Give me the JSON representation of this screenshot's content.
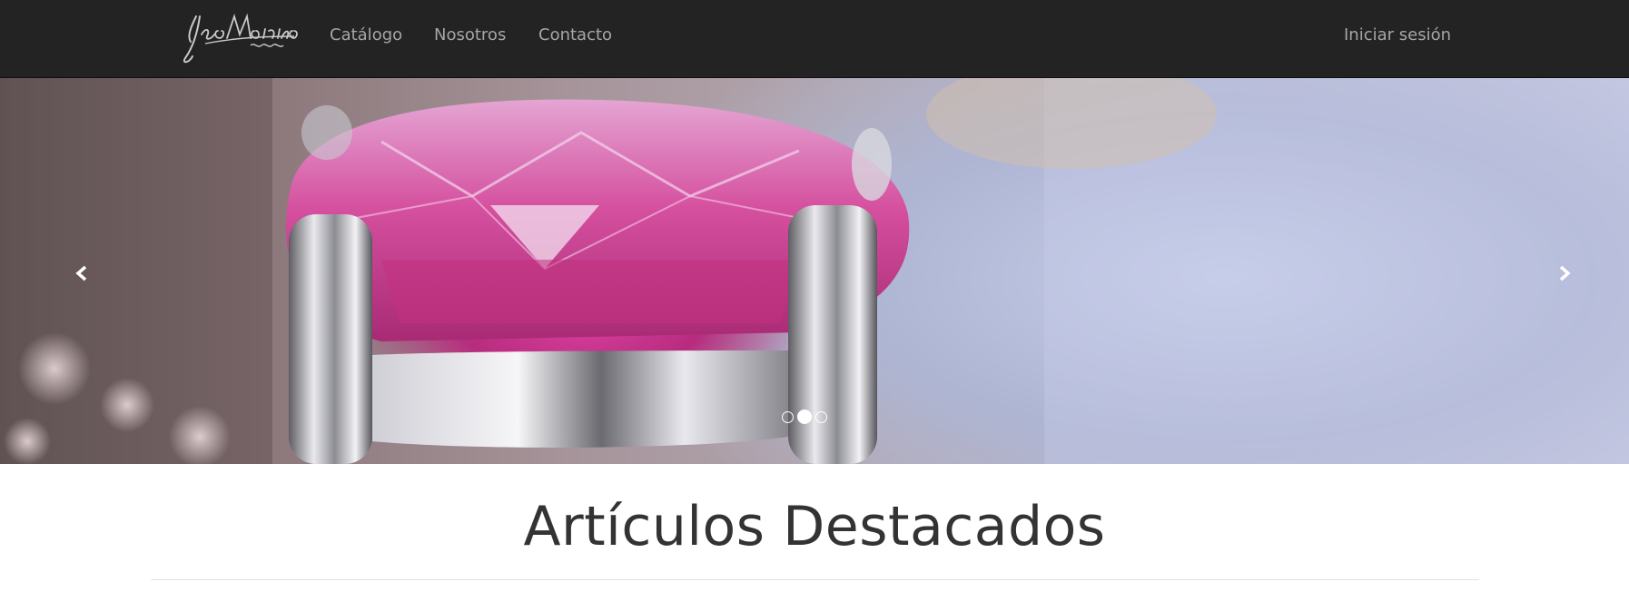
{
  "brand": {
    "logo_text": "YsaMarina",
    "logo_icon": "signature-logo"
  },
  "nav": {
    "links": [
      {
        "label": "Catálogo"
      },
      {
        "label": "Nosotros"
      },
      {
        "label": "Contacto"
      }
    ],
    "login_label": "Iniciar sesión"
  },
  "carousel": {
    "prev_icon": "chevron-left-icon",
    "next_icon": "chevron-right-icon",
    "slide_count": 3,
    "active_slide": 2,
    "slide_image": "pink-gem-ring-closeup"
  },
  "featured": {
    "title": "Artículos Destacados"
  },
  "colors": {
    "navbar_bg": "#232323",
    "nav_text": "#a6a6a6",
    "title_text": "#333333"
  }
}
